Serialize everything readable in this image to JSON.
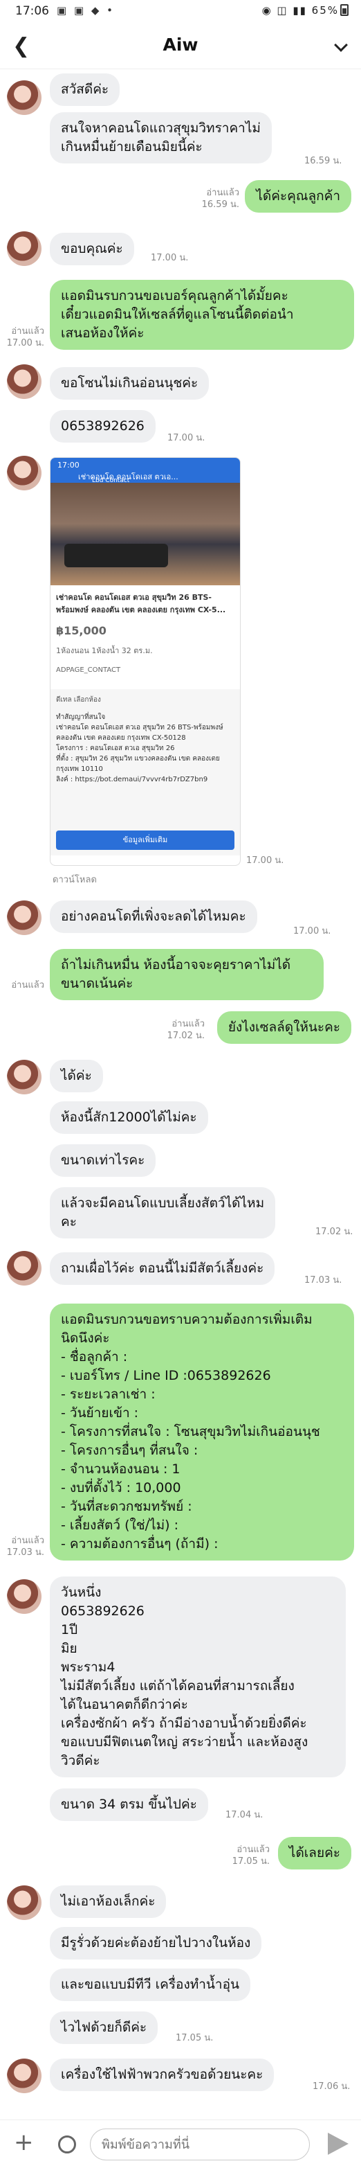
{
  "status": {
    "time": "17:06",
    "icons": "▣ ▣ ◆ •",
    "right": "◉ ◫ ▮▮ 65%"
  },
  "header": {
    "title": "Aiw"
  },
  "messages": {
    "m1": "สวัสดีค่ะ",
    "m2": "สนใจหาคอนโดแถวสุขุมวิทราคาไม่\nเกินหมื่นย้ายเดือนมิยนี้ค่ะ",
    "m3_meta": "อ่านแล้ว\n16.59 น.",
    "m3_time": "16.59 น.",
    "m3": "ได้ค่ะคุณลูกค้า",
    "m4": "ขอบคุณค่ะ",
    "m4_time": "17.00 น.",
    "m5_meta": "อ่านแล้ว\n17.00 น.",
    "m5": "แอดมินรบกวนขอเบอร์คุณลูกค้าได้มั้ยคะ\nเดี๋ยวแอดมินให้เซลล์ที่ดูแลโซนนี้ติดต่อนำ\nเสนอห้องให้ค่ะ",
    "m6": "ขอโซนไม่เกินอ่อนนุชค่ะ",
    "m7": "0653892626",
    "m7_time": "17.00 น.",
    "img_time": "17.00 น.",
    "download": "ดาวน์โหลด",
    "m8": "อย่างคอนโดที่เพิ่งจะลดได้ไหมคะ",
    "m8_time": "17.00 น.",
    "m9_meta": "อ่านแล้ว",
    "m9": "ถ้าไม่เกินหมื่น ห้องนี้อาจจะคุยราคาไม่ได้\nขนาดเน้นค่ะ",
    "m10_meta": "อ่านแล้ว\n17.02 น.",
    "m10": "ยังไงเซลล์ดูให้นะคะ",
    "m11": "ได้ค่ะ",
    "m12": "ห้องนี้สัก12000ได้ไม่คะ",
    "m13": "ขนาดเท่าไรคะ",
    "m14": "แล้วจะมีคอนโดแบบเลี้ยงสัตว์ได้ไหม\nคะ",
    "m14_time": "17.02 น.",
    "m15": "ถามเผื่อไว้ค่ะ ตอนนี้ไม่มีสัตว์เลี้ยงค่ะ",
    "m15_time": "17.03 น.",
    "m16_meta": "อ่านแล้ว\n17.03 น.",
    "m16": "แอดมินรบกวนขอทราบความต้องการเพิ่มเติม\nนิดนึงค่ะ\n- ชื่อลูกค้า :\n- เบอร์โทร / Line ID :0653892626\n- ระยะเวลาเช่า :\n- วันย้ายเข้า :\n- โครงการที่สนใจ : โซนสุขุมวิทไม่เกินอ่อนนุช\n- โครงการอื่นๆ ที่สนใจ :\n- จำนวนห้องนอน : 1\n- งบที่ตั้งไว้ : 10,000\n- วันที่สะดวกชมทรัพย์ :\n- เลี้ยงสัตว์ (ใช่/ไม่) :\n- ความต้องการอื่นๆ (ถ้ามี) :",
    "m17": "วันหนึ่ง\n0653892626\n1ปี\nมิย\nพระราม4\nไม่มีสัตว์เลี้ยง แต่ถ้าได้คอนที่สามารถเลี้ยง\nได้ในอนาคตก็ดีกว่าค่ะ\nเครื่องซักผ้า ครัว ถ้ามีอ่างอาบน้ำด้วยยิ่งดีค่ะ\nขอแบบมีฟิตเนตใหญ่ สระว่ายน้ำ และห้องสูง\nวิวดีค่ะ",
    "m18": "ขนาด 34 ตรม ขึ้นไปค่ะ",
    "m18_time": "17.04 น.",
    "m19_meta": "อ่านแล้ว\n17.05 น.",
    "m19": "ได้เลยค่ะ",
    "m20": "ไม่เอาห้องเล็กค่ะ",
    "m21": "มีรูรั่วด้วยค่ะต้องย้ายไปวางในห้อง",
    "m22": "และขอแบบมีทีวี เครื่องทำน้ำอุ่น",
    "m23": "ไวไฟด้วยก็ดีค่ะ",
    "m23_time": "17.05 น.",
    "m24": "เครื่องใช้ไฟฟ้าพวกครัวขอด้วยนะคะ",
    "m24_time": "17.06 น."
  },
  "listing": {
    "top_time": "17:00",
    "top_title": "เช่าคอนโด คอนโดเอส ตวเอ...",
    "top_sub": "Lbd Contact",
    "title": "เช่าคอนโด คอนโดเอส ตวเอ สุขุมวิท 26 BTS-\nพร้อมพงษ์ คลองตัน เขต คลองเตย กรุงเทพ CX-5...",
    "price": "฿15,000",
    "specs": "1ห้องนอน  1ห้องน้ำ  32 ตร.ม.",
    "contact": "ADPAGE_CONTACT",
    "msg_head": "ดีเทล เลือกห้อง",
    "msg_body": "ทำสัญญาที่สนใจ\nเช่าคอนโด คอนโดเอส ตวเอ สุขุมวิท 26 BTS-พร้อมพงษ์\nคลองตัน เขต คลองเตย กรุงเทพ CX-50128\nโครงการ : คอนโดเอส ตวเอ สุขุมวิท 26\nที่ตั้ง : สุขุมวิท 26 สุขุมวิท แขวงคลองตัน เขต คลองเตย\nกรุงเทพ 10110\nลิงค์ : https://bot.demaui/7vvvr4rb7rDZ7bn9",
    "button": "ข้อมูลเพิ่มเติม"
  },
  "input": {
    "placeholder": "พิมพ์ข้อความที่นี่"
  }
}
